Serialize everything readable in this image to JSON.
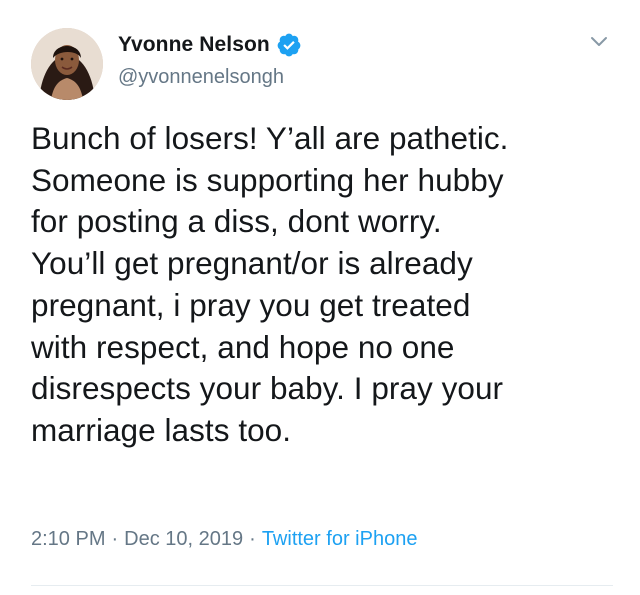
{
  "tweet": {
    "author": {
      "display_name": "Yvonne Nelson",
      "handle": "@yvonnenelsongh",
      "verified": true,
      "avatar_icon": "profile-photo"
    },
    "text": "Bunch of losers! Y’all are pathetic.\nSomeone is supporting her hubby\nfor posting a diss, dont worry.\nYou’ll get pregnant/or is already\npregnant, i pray you get treated\nwith respect, and hope no one\ndisrespects your baby. I pray your\nmarriage lasts too.",
    "time": "2:10 PM",
    "separator": "·",
    "date": "Dec 10, 2019",
    "source": "Twitter for iPhone"
  },
  "colors": {
    "verified": "#1da1f2",
    "link": "#1da1f2",
    "secondary_text": "#657786",
    "primary_text": "#14171a"
  },
  "icons": {
    "verified": "verified-badge-icon",
    "menu": "chevron-down-icon"
  }
}
